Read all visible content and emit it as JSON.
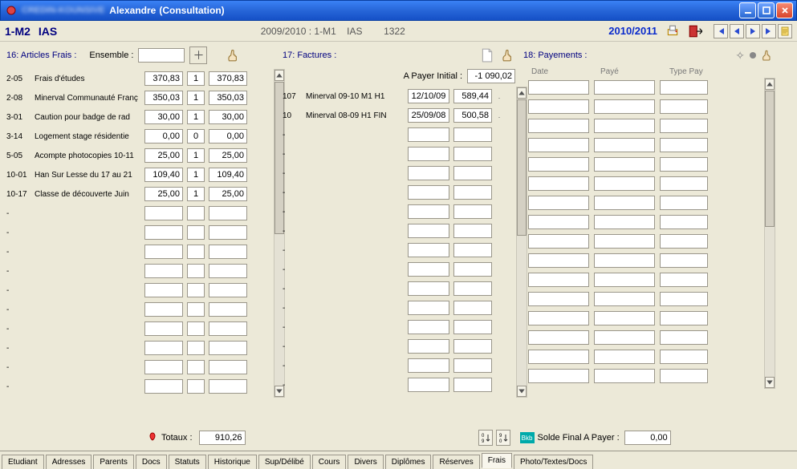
{
  "title": {
    "blurred": "CREDIN-KOUNSIVE",
    "name": "Alexandre",
    "suffix": "(Consultation)"
  },
  "header": {
    "left1": "1-M2",
    "left2": "IAS",
    "mid1": "2009/2010 : 1-M1",
    "mid2": "IAS",
    "mid3": "1322",
    "year": "2010/2011"
  },
  "articles": {
    "section": "16: Articles Frais :",
    "ensemble_label": "Ensemble :",
    "rows": [
      {
        "code": "2-05",
        "desc": "Frais d'études",
        "amt": "370,83",
        "qty": "1",
        "tot": "370,83"
      },
      {
        "code": "2-08",
        "desc": "Minerval Communauté Franç",
        "amt": "350,03",
        "qty": "1",
        "tot": "350,03"
      },
      {
        "code": "3-01",
        "desc": "Caution pour badge de rad",
        "amt": "30,00",
        "qty": "1",
        "tot": "30,00"
      },
      {
        "code": "3-14",
        "desc": "Logement stage résidentie",
        "amt": "0,00",
        "qty": "0",
        "tot": "0,00"
      },
      {
        "code": "5-05",
        "desc": "Acompte photocopies 10-11",
        "amt": "25,00",
        "qty": "1",
        "tot": "25,00"
      },
      {
        "code": "10-01",
        "desc": "Han Sur Lesse du 17 au 21",
        "amt": "109,40",
        "qty": "1",
        "tot": "109,40"
      },
      {
        "code": "10-17",
        "desc": "Classe de découverte Juin",
        "amt": "25,00",
        "qty": "1",
        "tot": "25,00"
      }
    ],
    "totaux_label": "Totaux :",
    "totaux_value": "910,26"
  },
  "factures": {
    "section": "17: Factures :",
    "apayer_label": "A Payer Initial :",
    "apayer_value": "-1 090,02",
    "rows": [
      {
        "code": "107",
        "desc": "Minerval 09-10 M1 H1",
        "date": "12/10/09",
        "amt": "589,44"
      },
      {
        "code": "10",
        "desc": "Minerval 08-09 H1 FIN",
        "date": "25/09/08",
        "amt": "500,58"
      }
    ]
  },
  "pay": {
    "section": "18: Payements :",
    "col_date": "Date",
    "col_paid": "Payé",
    "col_type": "Type Pay"
  },
  "footer": {
    "solde_label": "Solde Final A Payer :",
    "solde_value": "0,00"
  },
  "tabs": [
    "Etudiant",
    "Adresses",
    "Parents",
    "Docs",
    "Statuts",
    "Historique",
    "Sup/Délibé",
    "Cours",
    "Divers",
    "Diplômes",
    "Réserves",
    "Frais",
    "Photo/Textes/Docs"
  ],
  "active_tab": "Frais"
}
